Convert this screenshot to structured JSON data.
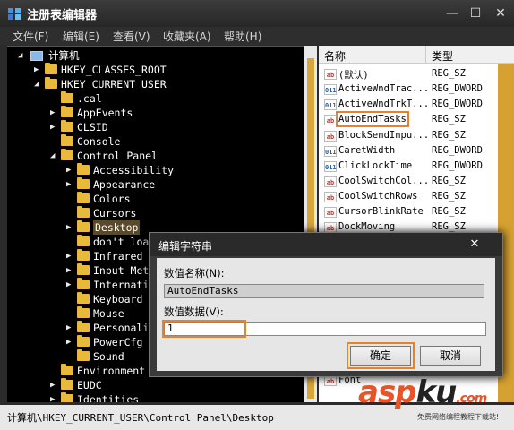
{
  "window": {
    "title": "注册表编辑器",
    "minimize": "—",
    "maximize": "☐",
    "close": "✕"
  },
  "menu": [
    "文件(F)",
    "编辑(E)",
    "查看(V)",
    "收藏夹(A)",
    "帮助(H)"
  ],
  "tree": {
    "root": "计算机",
    "nodes": [
      {
        "label": "HKEY_CLASSES_ROOT"
      },
      {
        "label": "HKEY_CURRENT_USER"
      },
      {
        "label": ".cal"
      },
      {
        "label": "AppEvents"
      },
      {
        "label": "CLSID"
      },
      {
        "label": "Console"
      },
      {
        "label": "Control Panel"
      },
      {
        "label": "Accessibility"
      },
      {
        "label": "Appearance"
      },
      {
        "label": "Colors"
      },
      {
        "label": "Cursors"
      },
      {
        "label": "Desktop"
      },
      {
        "label": "don't load"
      },
      {
        "label": "Infrared"
      },
      {
        "label": "Input Meth"
      },
      {
        "label": "Internatio"
      },
      {
        "label": "Keyboard"
      },
      {
        "label": "Mouse"
      },
      {
        "label": "Personaliz"
      },
      {
        "label": "PowerCfg"
      },
      {
        "label": "Sound"
      },
      {
        "label": "Environment"
      },
      {
        "label": "EUDC"
      },
      {
        "label": "Identities"
      }
    ]
  },
  "values": {
    "header_name": "名称",
    "header_type": "类型",
    "rows": [
      {
        "name": "(默认)",
        "type": "REG_SZ",
        "icon": "string-value-icon"
      },
      {
        "name": "ActiveWndTrac...",
        "type": "REG_DWORD",
        "icon": "dword-value-icon"
      },
      {
        "name": "ActiveWndTrkT...",
        "type": "REG_DWORD",
        "icon": "dword-value-icon"
      },
      {
        "name": "AutoEndTasks",
        "type": "REG_SZ",
        "icon": "string-value-icon"
      },
      {
        "name": "BlockSendInpu...",
        "type": "REG_SZ",
        "icon": "string-value-icon"
      },
      {
        "name": "CaretWidth",
        "type": "REG_DWORD",
        "icon": "dword-value-icon"
      },
      {
        "name": "ClickLockTime",
        "type": "REG_DWORD",
        "icon": "dword-value-icon"
      },
      {
        "name": "CoolSwitchCol...",
        "type": "REG_SZ",
        "icon": "string-value-icon"
      },
      {
        "name": "CoolSwitchRows",
        "type": "REG_SZ",
        "icon": "string-value-icon"
      },
      {
        "name": "CursorBlinkRate",
        "type": "REG_SZ",
        "icon": "string-value-icon"
      },
      {
        "name": "DockMoving",
        "type": "REG_SZ",
        "icon": "string-value-icon"
      }
    ],
    "partial_bottom": "Font"
  },
  "status": "计算机\\HKEY_CURRENT_USER\\Control Panel\\Desktop",
  "dialog": {
    "title": "编辑字符串",
    "name_label": "数值名称(N):",
    "name_value": "AutoEndTasks",
    "data_label": "数值数据(V):",
    "data_value": "1",
    "ok": "确定",
    "cancel": "取消",
    "close": "✕"
  },
  "watermark": {
    "brand_a": "asp",
    "brand_b": "ku",
    "brand_c": ".com",
    "tagline": "免费网络编程教程下载站!"
  },
  "colors": {
    "highlight": "#e8822a",
    "folder": "#e8b93a"
  }
}
